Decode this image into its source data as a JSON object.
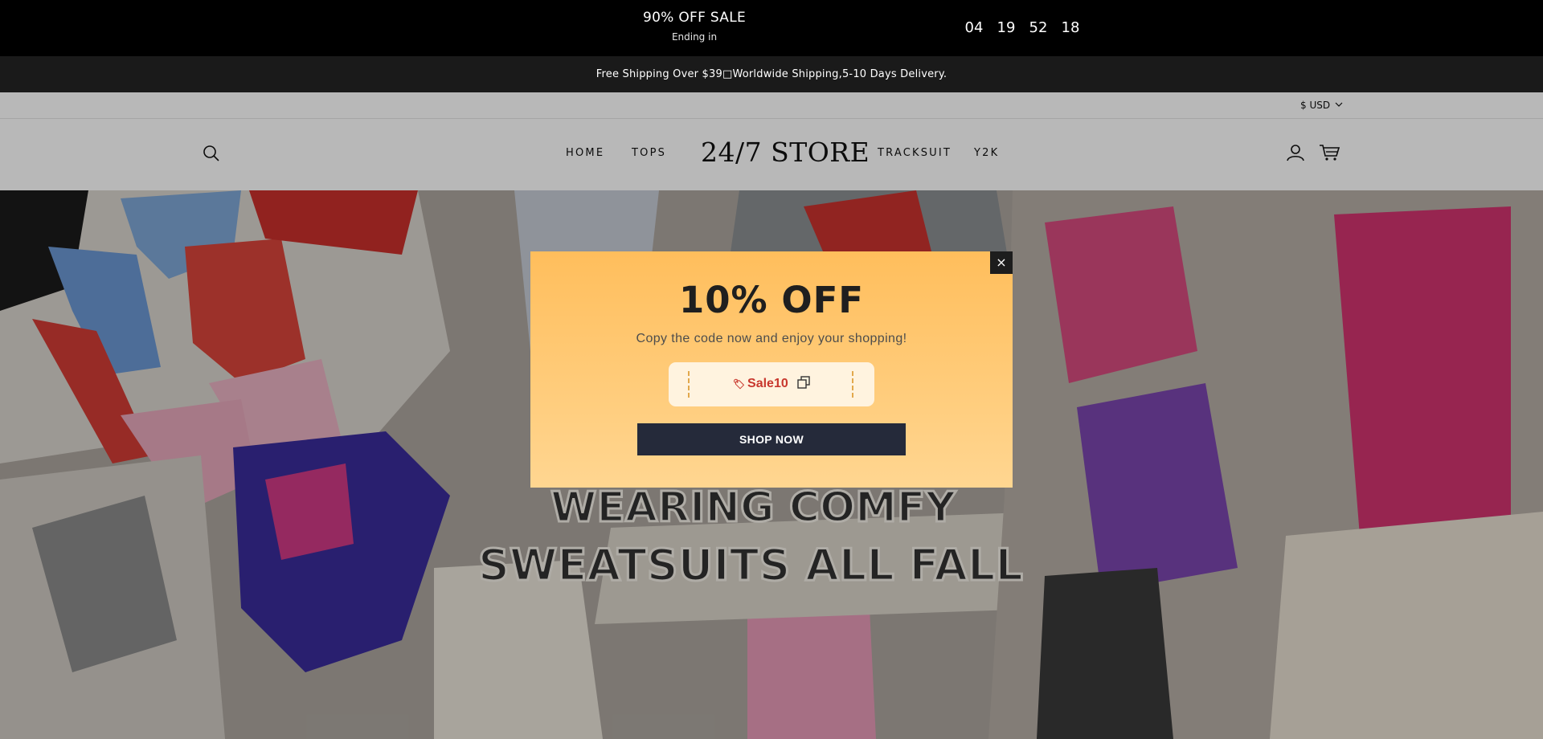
{
  "countdown": {
    "title": "90% OFF SALE",
    "subtitle": "Ending in",
    "days": "04",
    "hours": "19",
    "minutes": "52",
    "seconds": "18"
  },
  "announcement": {
    "text": "Free Shipping Over $39□Worldwide Shipping,5-10 Days Delivery."
  },
  "header": {
    "currency": "$ USD",
    "logo": "24/7 STORE",
    "nav": [
      "HOME",
      "TOPS",
      "TRACKSUIT",
      "Y2K"
    ],
    "icons": {
      "search": "search-icon",
      "account": "account-icon",
      "cart": "cart-icon"
    }
  },
  "hero": {
    "caption_line1": "WEARING COMFY",
    "caption_line2": "SWEATSUITS ALL FALL"
  },
  "popup": {
    "headline": "10% OFF",
    "subline": "Copy the code now and enjoy your shopping!",
    "coupon_code": "Sale10",
    "button_label": "SHOP NOW",
    "close_label": "×"
  },
  "colors": {
    "popup_top": "#ffbe5c",
    "popup_bottom": "#ffd691",
    "coupon_text": "#c8372d",
    "button_bg": "#252a3a"
  }
}
